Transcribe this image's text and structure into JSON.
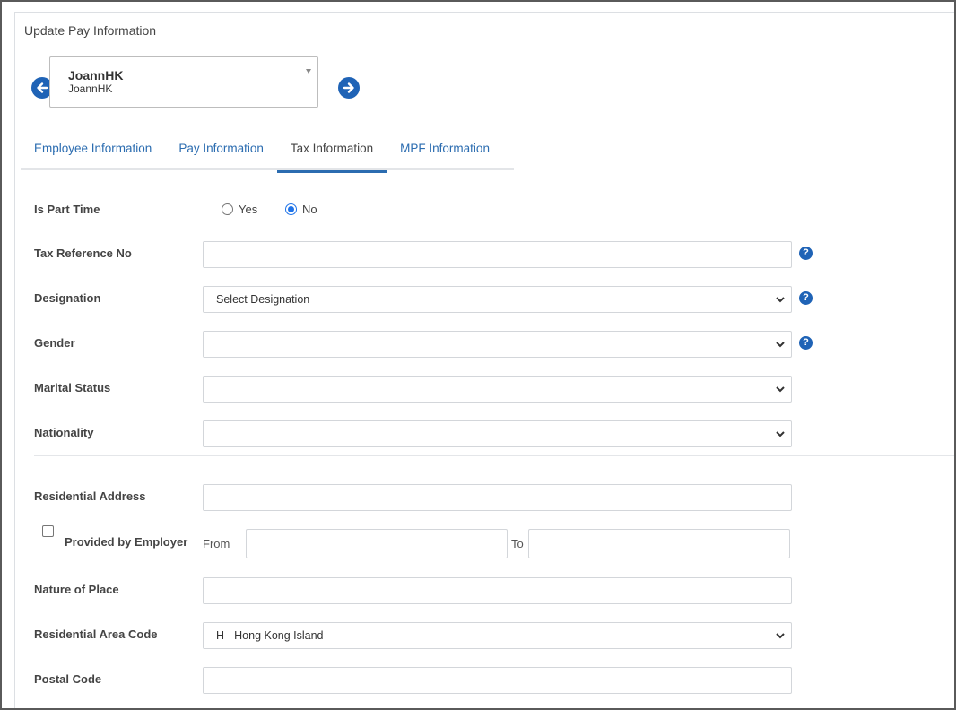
{
  "header": {
    "title": "Update Pay Information"
  },
  "employee": {
    "name": "JoannHK",
    "sub": "JoannHK"
  },
  "tabs": [
    {
      "label": "Employee Information",
      "active": false
    },
    {
      "label": "Pay Information",
      "active": false
    },
    {
      "label": "Tax Information",
      "active": true
    },
    {
      "label": "MPF Information",
      "active": false
    }
  ],
  "form": {
    "part_time": {
      "label": "Is Part Time",
      "options": [
        "Yes",
        "No"
      ],
      "selected": "No"
    },
    "tax_ref": {
      "label": "Tax Reference No",
      "value": ""
    },
    "designation": {
      "label": "Designation",
      "value": "Select Designation"
    },
    "gender": {
      "label": "Gender",
      "value": ""
    },
    "marital": {
      "label": "Marital Status",
      "value": ""
    },
    "nationality": {
      "label": "Nationality",
      "value": ""
    },
    "res_address": {
      "label": "Residential Address",
      "value": ""
    },
    "provided": {
      "label": "Provided by Employer",
      "from_label": "From",
      "to_label": "To",
      "from_value": "",
      "to_value": "",
      "checked": false
    },
    "nature": {
      "label": "Nature of Place",
      "value": ""
    },
    "area_code": {
      "label": "Residential Area Code",
      "value": "H - Hong Kong Island"
    },
    "postal": {
      "label": "Postal Code",
      "value": ""
    }
  },
  "help_glyph": "?",
  "colors": {
    "accent": "#1f63b6",
    "link": "#2b6cb0"
  }
}
